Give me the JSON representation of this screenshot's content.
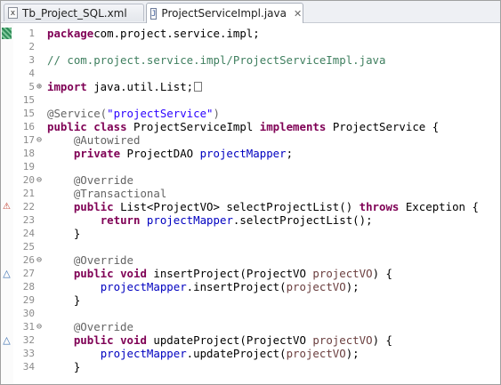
{
  "tabs": [
    {
      "label": "Tb_Project_SQL.xml",
      "icon": "x"
    },
    {
      "label": "ProjectServiceImpl.java",
      "icon": "J",
      "close": "✕"
    }
  ],
  "lines": [
    {
      "num": "1",
      "fold": "",
      "marker": "bookmark",
      "parts": [
        [
          "kw",
          "package"
        ],
        [
          "",
          "com.project.service.impl;"
        ]
      ]
    },
    {
      "num": "2",
      "fold": "",
      "marker": "",
      "parts": []
    },
    {
      "num": "3",
      "fold": "",
      "marker": "",
      "parts": [
        [
          "cmt",
          "// com.project.service.impl/ProjectServiceImpl.java"
        ]
      ]
    },
    {
      "num": "4",
      "fold": "",
      "marker": "",
      "parts": []
    },
    {
      "num": "5",
      "fold": "⊕",
      "marker": "",
      "parts": [
        [
          "kw",
          "import"
        ],
        [
          "",
          " java.util.List;"
        ],
        [
          "box",
          ""
        ]
      ]
    },
    {
      "num": "15",
      "fold": "",
      "marker": "",
      "parts": []
    },
    {
      "num": "15",
      "fold": "",
      "marker": "",
      "parts": [
        [
          "ann",
          "@Service("
        ],
        [
          "str",
          "\"projectService\""
        ],
        [
          "ann",
          ")"
        ]
      ]
    },
    {
      "num": "16",
      "fold": "",
      "marker": "",
      "parts": [
        [
          "kw",
          "public"
        ],
        [
          "",
          " "
        ],
        [
          "kw",
          "class"
        ],
        [
          "",
          " ProjectServiceImpl "
        ],
        [
          "kw",
          "implements"
        ],
        [
          "",
          " ProjectService {"
        ]
      ]
    },
    {
      "num": "17",
      "fold": "⊖",
      "marker": "",
      "parts": [
        [
          "",
          "    "
        ],
        [
          "ann",
          "@Autowired"
        ]
      ]
    },
    {
      "num": "18",
      "fold": "",
      "marker": "",
      "parts": [
        [
          "",
          "    "
        ],
        [
          "kw",
          "private"
        ],
        [
          "",
          " ProjectDAO "
        ],
        [
          "fld",
          "projectMapper"
        ],
        [
          "",
          ";"
        ]
      ]
    },
    {
      "num": "19",
      "fold": "",
      "marker": "",
      "parts": []
    },
    {
      "num": "20",
      "fold": "⊖",
      "marker": "",
      "parts": [
        [
          "",
          "    "
        ],
        [
          "ann",
          "@Override"
        ]
      ]
    },
    {
      "num": "21",
      "fold": "",
      "marker": "",
      "parts": [
        [
          "",
          "    "
        ],
        [
          "ann",
          "@Transactional"
        ]
      ]
    },
    {
      "num": "22",
      "fold": "",
      "marker": "impl",
      "parts": [
        [
          "",
          "    "
        ],
        [
          "kw",
          "public"
        ],
        [
          "",
          " List<ProjectVO> selectProjectList() "
        ],
        [
          "kw",
          "throws"
        ],
        [
          "",
          " Exception {"
        ]
      ]
    },
    {
      "num": "23",
      "fold": "",
      "marker": "",
      "parts": [
        [
          "",
          "        "
        ],
        [
          "kw",
          "return"
        ],
        [
          "",
          " "
        ],
        [
          "fld",
          "projectMapper"
        ],
        [
          "",
          ".selectProjectList();"
        ]
      ]
    },
    {
      "num": "24",
      "fold": "",
      "marker": "",
      "parts": [
        [
          "",
          "    }"
        ]
      ]
    },
    {
      "num": "25",
      "fold": "",
      "marker": "",
      "parts": []
    },
    {
      "num": "26",
      "fold": "⊖",
      "marker": "",
      "parts": [
        [
          "",
          "    "
        ],
        [
          "ann",
          "@Override"
        ]
      ]
    },
    {
      "num": "27",
      "fold": "",
      "marker": "override",
      "parts": [
        [
          "",
          "    "
        ],
        [
          "kw",
          "public"
        ],
        [
          "",
          " "
        ],
        [
          "kw",
          "void"
        ],
        [
          "",
          " insertProject(ProjectVO "
        ],
        [
          "prm",
          "projectVO"
        ],
        [
          "",
          ") {"
        ]
      ]
    },
    {
      "num": "28",
      "fold": "",
      "marker": "",
      "parts": [
        [
          "",
          "        "
        ],
        [
          "fld",
          "projectMapper"
        ],
        [
          "",
          ".insertProject("
        ],
        [
          "prm",
          "projectVO"
        ],
        [
          "",
          ");"
        ]
      ]
    },
    {
      "num": "29",
      "fold": "",
      "marker": "",
      "parts": [
        [
          "",
          "    }"
        ]
      ]
    },
    {
      "num": "30",
      "fold": "",
      "marker": "",
      "parts": []
    },
    {
      "num": "31",
      "fold": "⊖",
      "marker": "",
      "parts": [
        [
          "",
          "    "
        ],
        [
          "ann",
          "@Override"
        ]
      ]
    },
    {
      "num": "32",
      "fold": "",
      "marker": "override",
      "parts": [
        [
          "",
          "    "
        ],
        [
          "kw",
          "public"
        ],
        [
          "",
          " "
        ],
        [
          "kw",
          "void"
        ],
        [
          "",
          " updateProject(ProjectVO "
        ],
        [
          "prm",
          "projectVO"
        ],
        [
          "",
          ") {"
        ]
      ]
    },
    {
      "num": "33",
      "fold": "",
      "marker": "",
      "parts": [
        [
          "",
          "        "
        ],
        [
          "fld",
          "projectMapper"
        ],
        [
          "",
          ".updateProject("
        ],
        [
          "prm",
          "projectVO"
        ],
        [
          "",
          ");"
        ]
      ]
    },
    {
      "num": "34",
      "fold": "",
      "marker": "",
      "parts": [
        [
          "",
          "    }"
        ]
      ]
    }
  ]
}
